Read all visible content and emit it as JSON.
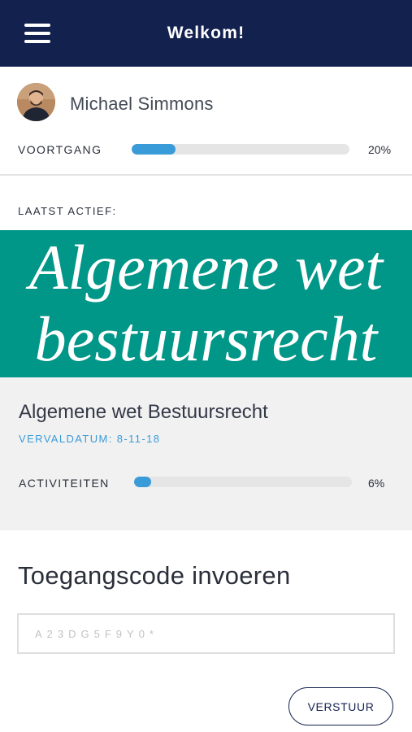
{
  "header": {
    "title": "Welkom!",
    "menu_icon": "menu-icon"
  },
  "user": {
    "name": "Michael Simmons",
    "avatar_icon": "avatar"
  },
  "progress": {
    "label": "VOORTGANG",
    "value": 0.2,
    "percent_text": "20%"
  },
  "last_active": {
    "label": "LAATST ACTIEF:",
    "banner_line1": "Algemene wet",
    "banner_line2": "bestuursrecht",
    "banner_color": "#009688",
    "course_title": "Algemene wet Bestuursrecht",
    "due_date": "VERVALDATUM: 8-11-18",
    "activities_label": "ACTIVITEITEN",
    "activities_value": 0.06,
    "activities_percent_text": "6%"
  },
  "access_code": {
    "heading": "Toegangscode invoeren",
    "placeholder": "A23DG5F9Y0*",
    "value": "",
    "submit_label": "VERSTUUR"
  },
  "colors": {
    "navy": "#13214f",
    "accent": "#3a9bd9",
    "teal": "#009688"
  }
}
